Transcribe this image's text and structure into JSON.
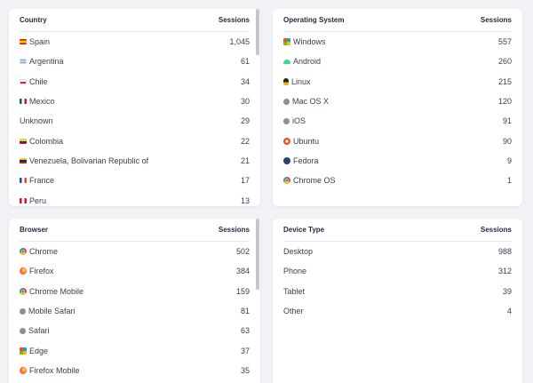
{
  "country": {
    "header": {
      "label": "Country",
      "metric": "Sessions"
    },
    "rows": [
      {
        "label": "Spain",
        "value": "1,045",
        "icon": "flag-spain-icon"
      },
      {
        "label": "Argentina",
        "value": "61",
        "icon": "flag-argentina-icon"
      },
      {
        "label": "Chile",
        "value": "34",
        "icon": "flag-chile-icon"
      },
      {
        "label": "Mexico",
        "value": "30",
        "icon": "flag-mexico-icon"
      },
      {
        "label": "Unknown",
        "value": "29",
        "icon": ""
      },
      {
        "label": "Colombia",
        "value": "22",
        "icon": "flag-colombia-icon"
      },
      {
        "label": "Venezuela, Bolivarian Republic of",
        "value": "21",
        "icon": "flag-venezuela-icon"
      },
      {
        "label": "France",
        "value": "17",
        "icon": "flag-france-icon"
      },
      {
        "label": "Peru",
        "value": "13",
        "icon": "flag-peru-icon"
      }
    ]
  },
  "os": {
    "header": {
      "label": "Operating System",
      "metric": "Sessions"
    },
    "rows": [
      {
        "label": "Windows",
        "value": "557",
        "icon": "windows-icon"
      },
      {
        "label": "Android",
        "value": "260",
        "icon": "android-icon"
      },
      {
        "label": "Linux",
        "value": "215",
        "icon": "linux-icon"
      },
      {
        "label": "Mac OS X",
        "value": "120",
        "icon": "apple-icon"
      },
      {
        "label": "iOS",
        "value": "91",
        "icon": "apple-icon"
      },
      {
        "label": "Ubuntu",
        "value": "90",
        "icon": "ubuntu-icon"
      },
      {
        "label": "Fedora",
        "value": "9",
        "icon": "fedora-icon"
      },
      {
        "label": "Chrome OS",
        "value": "1",
        "icon": "chrome-icon"
      }
    ]
  },
  "browser": {
    "header": {
      "label": "Browser",
      "metric": "Sessions"
    },
    "rows": [
      {
        "label": "Chrome",
        "value": "502",
        "icon": "chrome-icon"
      },
      {
        "label": "Firefox",
        "value": "384",
        "icon": "firefox-icon"
      },
      {
        "label": "Chrome Mobile",
        "value": "159",
        "icon": "chrome-icon"
      },
      {
        "label": "Mobile Safari",
        "value": "81",
        "icon": "safari-icon"
      },
      {
        "label": "Safari",
        "value": "63",
        "icon": "safari-icon"
      },
      {
        "label": "Edge",
        "value": "37",
        "icon": "edge-icon"
      },
      {
        "label": "Firefox Mobile",
        "value": "35",
        "icon": "firefox-icon"
      }
    ]
  },
  "device": {
    "header": {
      "label": "Device Type",
      "metric": "Sessions"
    },
    "rows": [
      {
        "label": "Desktop",
        "value": "988"
      },
      {
        "label": "Phone",
        "value": "312"
      },
      {
        "label": "Tablet",
        "value": "39"
      },
      {
        "label": "Other",
        "value": "4"
      }
    ]
  }
}
